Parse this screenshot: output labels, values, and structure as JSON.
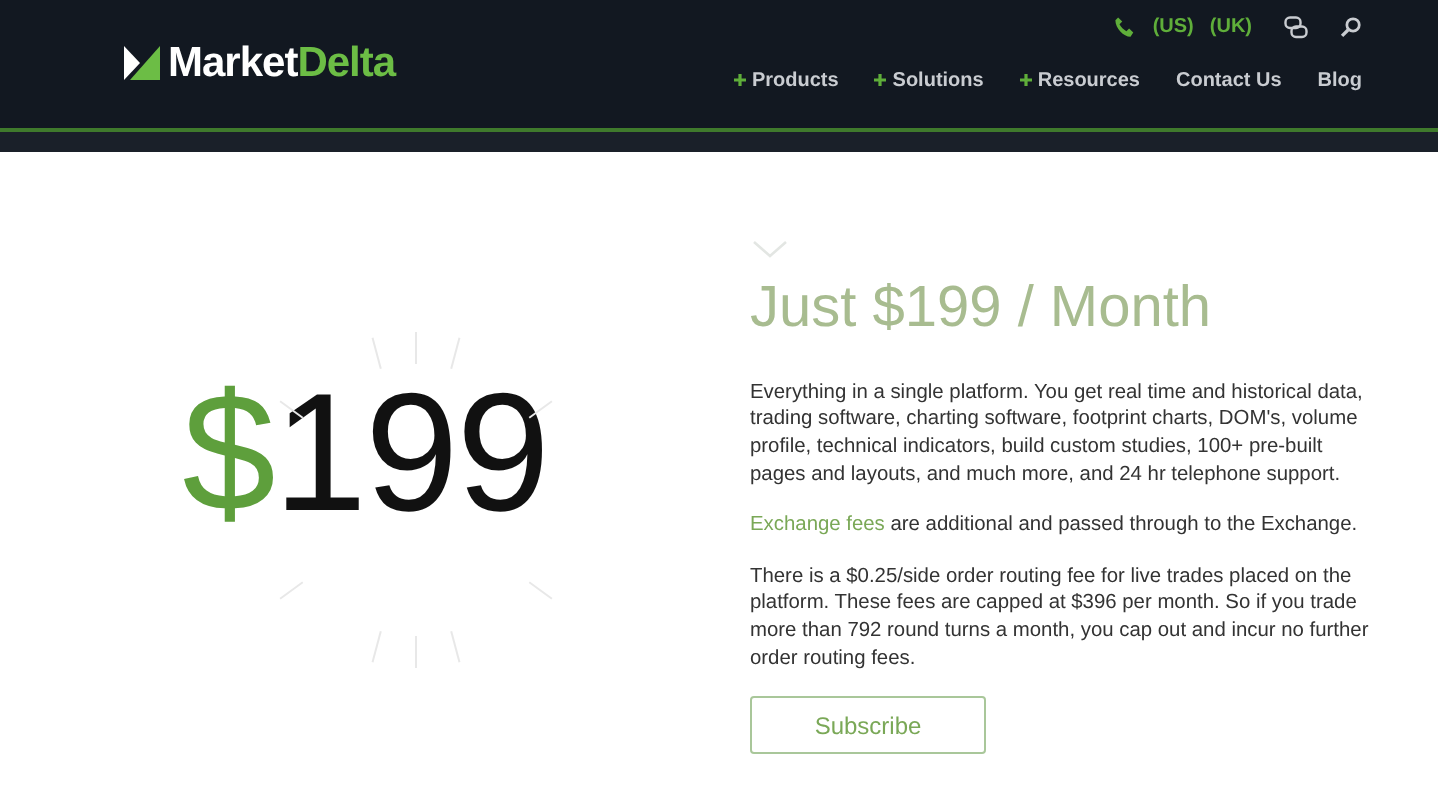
{
  "header": {
    "logo": {
      "first": "Market",
      "second": "Delta"
    },
    "regions": [
      "(US)",
      "(UK)"
    ],
    "nav": [
      {
        "label": "Products",
        "expandable": true
      },
      {
        "label": "Solutions",
        "expandable": true
      },
      {
        "label": "Resources",
        "expandable": true
      },
      {
        "label": "Contact Us",
        "expandable": false
      },
      {
        "label": "Blog",
        "expandable": false
      }
    ]
  },
  "price_display": {
    "symbol": "$",
    "amount": "199"
  },
  "offer": {
    "title": "Just $199 / Month",
    "description": "Everything in a single platform. You get real time and historical data, trading software, charting software, footprint charts, DOM's, volume profile, technical indicators, build custom studies, 100+ pre-built pages and layouts, and much more, and 24 hr telephone support.",
    "fees_link": "Exchange fees",
    "fees_text": " are additional and passed through to the Exchange.",
    "routing": "There is a $0.25/side order routing fee for live trades placed on the platform. These fees are capped at $396 per month.  So if you trade more than 792 round turns a month, you cap out and incur no further order routing fees.",
    "button": "Subscribe"
  }
}
